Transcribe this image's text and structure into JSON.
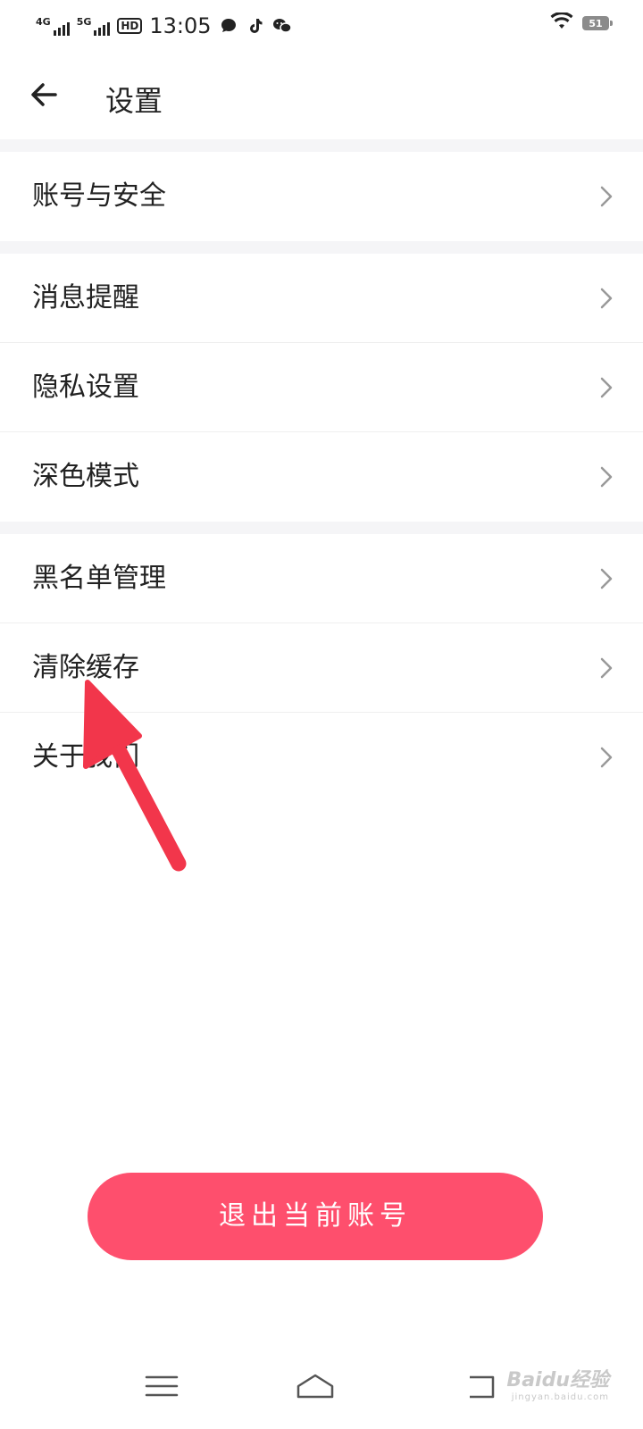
{
  "status_bar": {
    "net1": "4G",
    "net2": "5G",
    "hd": "HD",
    "time": "13:05",
    "battery": "51"
  },
  "header": {
    "title": "设置"
  },
  "menu": {
    "items": [
      {
        "label": "账号与安全"
      },
      {
        "label": "消息提醒"
      },
      {
        "label": "隐私设置"
      },
      {
        "label": "深色模式"
      },
      {
        "label": "黑名单管理"
      },
      {
        "label": "清除缓存"
      },
      {
        "label": "关于我们"
      }
    ]
  },
  "logout_label": "退出当前账号",
  "watermark": {
    "text": "Baidu经验",
    "sub": "jingyan.baidu.com"
  },
  "colors": {
    "accent": "#fe4f6d",
    "annotation_arrow": "#f2364b",
    "section_gap": "#f5f5f7"
  }
}
